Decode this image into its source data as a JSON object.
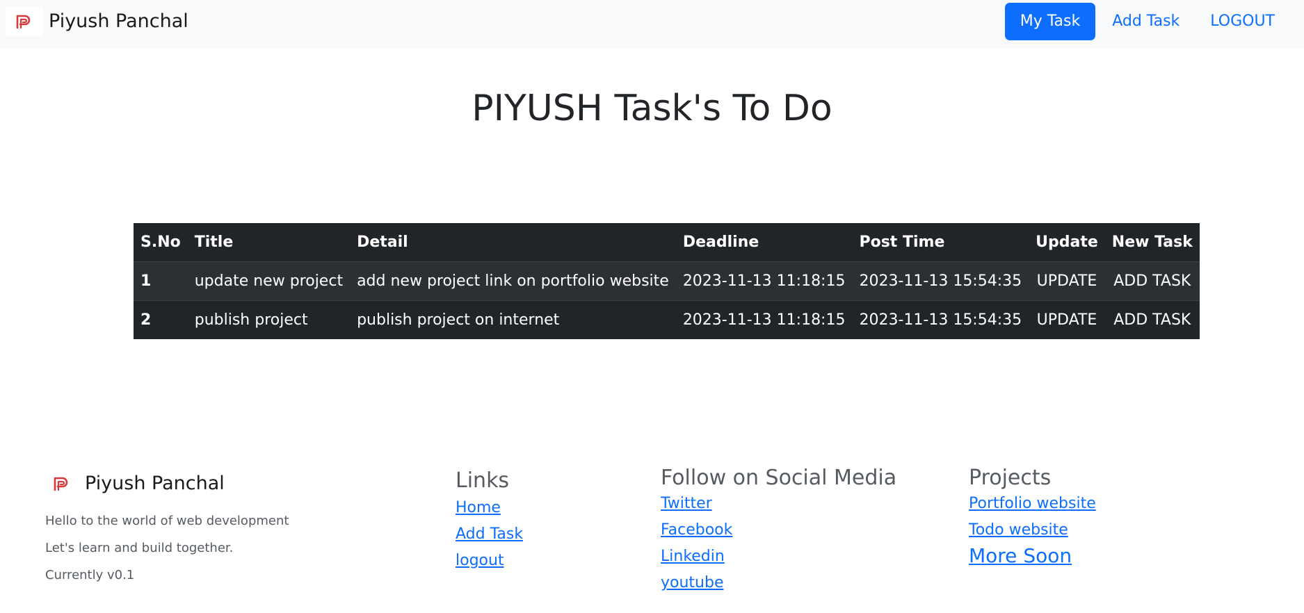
{
  "navbar": {
    "brand": "Piyush Panchal",
    "links": [
      {
        "label": "My Task",
        "active": true
      },
      {
        "label": "Add Task",
        "active": false
      },
      {
        "label": "LOGOUT",
        "active": false
      }
    ]
  },
  "page_title": "PIYUSH Task's To Do",
  "table": {
    "headers": [
      "S.No",
      "Title",
      "Detail",
      "Deadline",
      "Post Time",
      "Update",
      "New Task"
    ],
    "rows": [
      {
        "sno": "1",
        "title": "update new project",
        "detail": "add new project link on portfolio website",
        "deadline": "2023-11-13 11:18:15",
        "post_time": "2023-11-13 15:54:35",
        "update": "UPDATE",
        "new_task": "ADD TASK"
      },
      {
        "sno": "2",
        "title": "publish project",
        "detail": "publish project on internet",
        "deadline": "2023-11-13 11:18:15",
        "post_time": "2023-11-13 15:54:35",
        "update": "UPDATE",
        "new_task": "ADD TASK"
      }
    ]
  },
  "footer": {
    "brand": "Piyush Panchal",
    "lines": [
      "Hello to the world of web development",
      "Let's learn and build together.",
      "Currently v0.1"
    ],
    "links_col": {
      "title": "Links",
      "items": [
        "Home",
        "Add Task",
        "logout"
      ]
    },
    "social_col": {
      "title": "Follow on Social Media",
      "items": [
        "Twitter",
        "Facebook",
        "Linkedin",
        "youtube"
      ]
    },
    "projects_col": {
      "title": "Projects",
      "items": [
        "Portfolio website",
        "Todo website",
        "More Soon"
      ]
    }
  },
  "colors": {
    "accent": "#0d6efd",
    "table_bg": "#212529",
    "navbar_bg": "#f8f9fa",
    "logo_red": "#d63a3a"
  },
  "icons": {
    "brand_logo": "p-logo-icon"
  }
}
